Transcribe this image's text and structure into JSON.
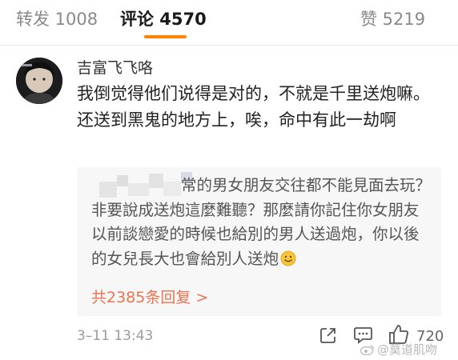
{
  "tabs": {
    "repost_label": "转发 1008",
    "comment_label": "评论 4570",
    "like_label": "赞 5219"
  },
  "comment": {
    "username": "吉富飞飞咯",
    "text": "我倒觉得他们说得是对的，不就是千里送炮嘛。还送到黑鬼的地方上，唉，命中有此一劫啊",
    "time": "3–11 13:43",
    "like_count": "720"
  },
  "reply": {
    "text": "常的男女朋友交往都不能見面去玩？非要說成送炮這麼難聽？那麼請你記住你女朋友以前談戀愛的時候也給別的男人送過炮，你以後的女兒長大也會給別人送炮",
    "more_label": "共2385条回复 >"
  },
  "watermark": {
    "text": "@莫道肌吻"
  },
  "icons": {
    "share": "share-icon",
    "comment": "comment-icon",
    "like": "thumbs-up-icon",
    "emoji": "smiley-emoji-icon"
  },
  "colors": {
    "accent": "#ff8200",
    "link": "#eb7350",
    "reply_bg": "#f7f7f7"
  }
}
